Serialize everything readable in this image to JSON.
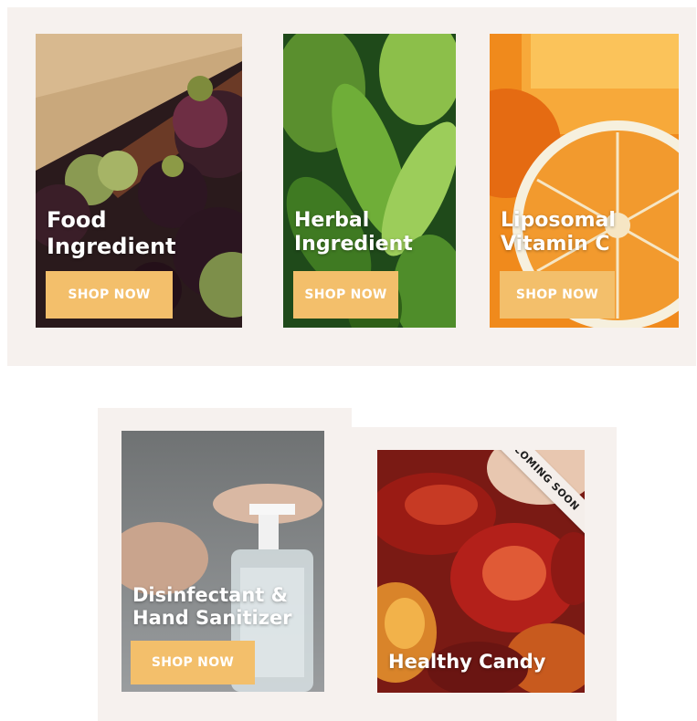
{
  "cards": [
    {
      "id": "food",
      "title_lines": [
        "Food",
        "Ingredient"
      ],
      "button_label": "SHOP NOW"
    },
    {
      "id": "herbal",
      "title_lines": [
        "Herbal",
        "Ingredient"
      ],
      "button_label": "SHOP NOW"
    },
    {
      "id": "vitamin",
      "title_lines": [
        "Liposomal",
        "Vitamin C"
      ],
      "button_label": "SHOP NOW"
    },
    {
      "id": "sanitizer",
      "title_lines": [
        "Disinfectant &",
        "Hand Sanitizer"
      ],
      "button_label": "SHOP NOW"
    },
    {
      "id": "candy",
      "title_lines": [
        "Healthy Candy"
      ],
      "ribbon": "COMING SOON"
    }
  ],
  "colors": {
    "panel_bg": "#f6f1ee",
    "button_bg": "#f3bf6b",
    "button_text": "#ffffff",
    "title_text": "#ffffff"
  }
}
